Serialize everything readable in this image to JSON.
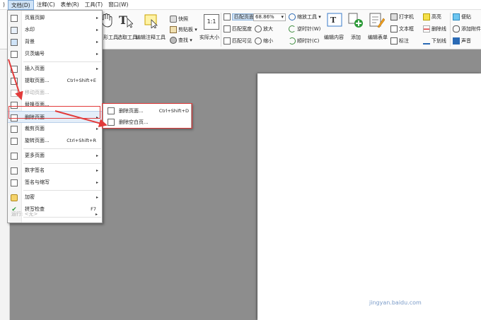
{
  "menubar": {
    "items": [
      {
        "label": ")",
        "active": false
      },
      {
        "label": "文档(D)",
        "active": true
      },
      {
        "label": "注释(C)",
        "active": false
      },
      {
        "label": "表单(R)",
        "active": false
      },
      {
        "label": "工具(T)",
        "active": false
      },
      {
        "label": "窗口(W)",
        "active": false
      }
    ]
  },
  "ribbon": {
    "hand_tool": "形工具",
    "select_tool": "选取工具",
    "edit_annot": "编辑注释工具",
    "snapshot": "快照",
    "clipboard": "剪贴板",
    "find": "查找",
    "actual_size": "实际大小",
    "fit_page": "匹配页面",
    "fit_width": "匹配宽度",
    "fit_visible": "匹配可见",
    "zoom_value": "68.86%",
    "zoom_tool": "缩放工具",
    "zoom_in": "放大",
    "zoom_out": "缩小",
    "rotate_ccw": "逆时针(W)",
    "rotate_cw": "顺时针(C)",
    "edit_content": "编辑内容",
    "add": "添加",
    "edit_form": "编辑表单",
    "typewriter": "打字机",
    "textbox": "文本框",
    "callout": "标注",
    "highlight": "高亮",
    "strikeout": "删除线",
    "underline": "下划线",
    "note": "便贴",
    "attach": "添加附件",
    "sound": "声音"
  },
  "menu": {
    "items": [
      {
        "label": "页眉页脚",
        "shortcut": "",
        "arrow": true,
        "disabled": false
      },
      {
        "label": "水印",
        "shortcut": "",
        "arrow": true,
        "disabled": false
      },
      {
        "label": "背景",
        "shortcut": "",
        "arrow": true,
        "disabled": false
      },
      {
        "label": "贝茨编号",
        "shortcut": "",
        "arrow": true,
        "disabled": false
      },
      {
        "label": "插入页面",
        "shortcut": "",
        "arrow": true,
        "disabled": false
      },
      {
        "label": "提取页面...",
        "shortcut": "Ctrl+Shift+E",
        "arrow": false,
        "disabled": false
      },
      {
        "label": "移动页面...",
        "shortcut": "",
        "arrow": false,
        "disabled": true
      },
      {
        "label": "替换页面...",
        "shortcut": "",
        "arrow": false,
        "disabled": false
      },
      {
        "label": "删除页面",
        "shortcut": "",
        "arrow": true,
        "disabled": false
      },
      {
        "label": "裁剪页面",
        "shortcut": "",
        "arrow": true,
        "disabled": false
      },
      {
        "label": "旋转页面...",
        "shortcut": "Ctrl+Shift+R",
        "arrow": false,
        "disabled": false
      },
      {
        "label": "更多页面",
        "shortcut": "",
        "arrow": true,
        "disabled": false
      },
      {
        "label": "数字签名",
        "shortcut": "",
        "arrow": true,
        "disabled": false
      },
      {
        "label": "签名与缩写",
        "shortcut": "",
        "arrow": true,
        "disabled": false
      },
      {
        "label": "加密",
        "shortcut": "",
        "arrow": true,
        "disabled": false
      },
      {
        "label": "拼写检查",
        "shortcut": "F7",
        "arrow": false,
        "disabled": false
      },
      {
        "label": "运行: <无>",
        "shortcut": "",
        "arrow": true,
        "disabled": true
      }
    ]
  },
  "submenu": {
    "items": [
      {
        "label": "删除页面...",
        "shortcut": "Ctrl+Shift+D"
      },
      {
        "label": "删除空白页..."
      }
    ]
  },
  "watermark": {
    "brand": "Baidu经验",
    "url": "jingyan.baidu.com"
  },
  "colors": {
    "accent": "#e23a3a",
    "highlight": "#cfe3f7",
    "workspace": "#8d8d8d"
  }
}
